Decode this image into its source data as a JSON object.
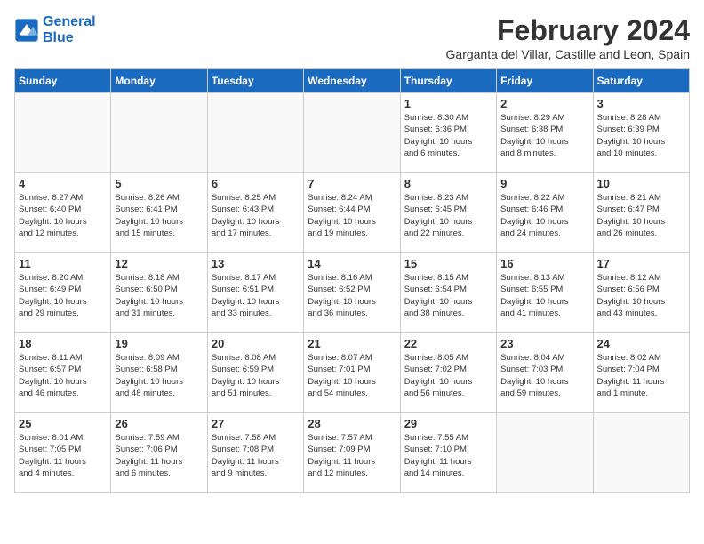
{
  "logo": {
    "line1": "General",
    "line2": "Blue"
  },
  "title": "February 2024",
  "location": "Garganta del Villar, Castille and Leon, Spain",
  "days_of_week": [
    "Sunday",
    "Monday",
    "Tuesday",
    "Wednesday",
    "Thursday",
    "Friday",
    "Saturday"
  ],
  "weeks": [
    [
      {
        "day": "",
        "info": ""
      },
      {
        "day": "",
        "info": ""
      },
      {
        "day": "",
        "info": ""
      },
      {
        "day": "",
        "info": ""
      },
      {
        "day": "1",
        "info": "Sunrise: 8:30 AM\nSunset: 6:36 PM\nDaylight: 10 hours\nand 6 minutes."
      },
      {
        "day": "2",
        "info": "Sunrise: 8:29 AM\nSunset: 6:38 PM\nDaylight: 10 hours\nand 8 minutes."
      },
      {
        "day": "3",
        "info": "Sunrise: 8:28 AM\nSunset: 6:39 PM\nDaylight: 10 hours\nand 10 minutes."
      }
    ],
    [
      {
        "day": "4",
        "info": "Sunrise: 8:27 AM\nSunset: 6:40 PM\nDaylight: 10 hours\nand 12 minutes."
      },
      {
        "day": "5",
        "info": "Sunrise: 8:26 AM\nSunset: 6:41 PM\nDaylight: 10 hours\nand 15 minutes."
      },
      {
        "day": "6",
        "info": "Sunrise: 8:25 AM\nSunset: 6:43 PM\nDaylight: 10 hours\nand 17 minutes."
      },
      {
        "day": "7",
        "info": "Sunrise: 8:24 AM\nSunset: 6:44 PM\nDaylight: 10 hours\nand 19 minutes."
      },
      {
        "day": "8",
        "info": "Sunrise: 8:23 AM\nSunset: 6:45 PM\nDaylight: 10 hours\nand 22 minutes."
      },
      {
        "day": "9",
        "info": "Sunrise: 8:22 AM\nSunset: 6:46 PM\nDaylight: 10 hours\nand 24 minutes."
      },
      {
        "day": "10",
        "info": "Sunrise: 8:21 AM\nSunset: 6:47 PM\nDaylight: 10 hours\nand 26 minutes."
      }
    ],
    [
      {
        "day": "11",
        "info": "Sunrise: 8:20 AM\nSunset: 6:49 PM\nDaylight: 10 hours\nand 29 minutes."
      },
      {
        "day": "12",
        "info": "Sunrise: 8:18 AM\nSunset: 6:50 PM\nDaylight: 10 hours\nand 31 minutes."
      },
      {
        "day": "13",
        "info": "Sunrise: 8:17 AM\nSunset: 6:51 PM\nDaylight: 10 hours\nand 33 minutes."
      },
      {
        "day": "14",
        "info": "Sunrise: 8:16 AM\nSunset: 6:52 PM\nDaylight: 10 hours\nand 36 minutes."
      },
      {
        "day": "15",
        "info": "Sunrise: 8:15 AM\nSunset: 6:54 PM\nDaylight: 10 hours\nand 38 minutes."
      },
      {
        "day": "16",
        "info": "Sunrise: 8:13 AM\nSunset: 6:55 PM\nDaylight: 10 hours\nand 41 minutes."
      },
      {
        "day": "17",
        "info": "Sunrise: 8:12 AM\nSunset: 6:56 PM\nDaylight: 10 hours\nand 43 minutes."
      }
    ],
    [
      {
        "day": "18",
        "info": "Sunrise: 8:11 AM\nSunset: 6:57 PM\nDaylight: 10 hours\nand 46 minutes."
      },
      {
        "day": "19",
        "info": "Sunrise: 8:09 AM\nSunset: 6:58 PM\nDaylight: 10 hours\nand 48 minutes."
      },
      {
        "day": "20",
        "info": "Sunrise: 8:08 AM\nSunset: 6:59 PM\nDaylight: 10 hours\nand 51 minutes."
      },
      {
        "day": "21",
        "info": "Sunrise: 8:07 AM\nSunset: 7:01 PM\nDaylight: 10 hours\nand 54 minutes."
      },
      {
        "day": "22",
        "info": "Sunrise: 8:05 AM\nSunset: 7:02 PM\nDaylight: 10 hours\nand 56 minutes."
      },
      {
        "day": "23",
        "info": "Sunrise: 8:04 AM\nSunset: 7:03 PM\nDaylight: 10 hours\nand 59 minutes."
      },
      {
        "day": "24",
        "info": "Sunrise: 8:02 AM\nSunset: 7:04 PM\nDaylight: 11 hours\nand 1 minute."
      }
    ],
    [
      {
        "day": "25",
        "info": "Sunrise: 8:01 AM\nSunset: 7:05 PM\nDaylight: 11 hours\nand 4 minutes."
      },
      {
        "day": "26",
        "info": "Sunrise: 7:59 AM\nSunset: 7:06 PM\nDaylight: 11 hours\nand 6 minutes."
      },
      {
        "day": "27",
        "info": "Sunrise: 7:58 AM\nSunset: 7:08 PM\nDaylight: 11 hours\nand 9 minutes."
      },
      {
        "day": "28",
        "info": "Sunrise: 7:57 AM\nSunset: 7:09 PM\nDaylight: 11 hours\nand 12 minutes."
      },
      {
        "day": "29",
        "info": "Sunrise: 7:55 AM\nSunset: 7:10 PM\nDaylight: 11 hours\nand 14 minutes."
      },
      {
        "day": "",
        "info": ""
      },
      {
        "day": "",
        "info": ""
      }
    ]
  ]
}
